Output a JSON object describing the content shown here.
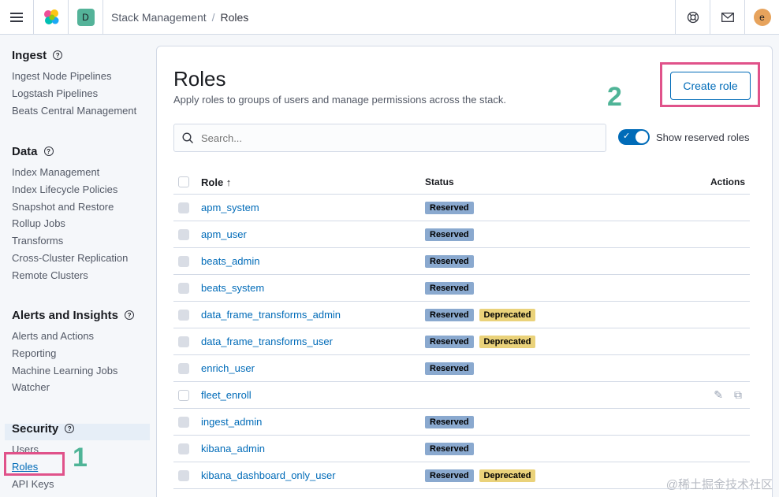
{
  "header": {
    "breadcrumbs": [
      "Stack Management",
      "Roles"
    ],
    "space_initial": "D",
    "user_initial": "e"
  },
  "sidebar": {
    "groups": [
      {
        "title": "Ingest",
        "items": [
          "Ingest Node Pipelines",
          "Logstash Pipelines",
          "Beats Central Management"
        ]
      },
      {
        "title": "Data",
        "items": [
          "Index Management",
          "Index Lifecycle Policies",
          "Snapshot and Restore",
          "Rollup Jobs",
          "Transforms",
          "Cross-Cluster Replication",
          "Remote Clusters"
        ]
      },
      {
        "title": "Alerts and Insights",
        "items": [
          "Alerts and Actions",
          "Reporting",
          "Machine Learning Jobs",
          "Watcher"
        ]
      },
      {
        "title": "Security",
        "items": [
          "Users",
          "Roles",
          "API Keys"
        ]
      }
    ],
    "active_item": "Roles"
  },
  "annotations": {
    "step1": "1",
    "step2": "2"
  },
  "main": {
    "title": "Roles",
    "description": "Apply roles to groups of users and manage permissions across the stack.",
    "create_button": "Create role",
    "search_placeholder": "Search...",
    "toggle_label": "Show reserved roles",
    "toggle_on": true,
    "columns": {
      "role": "Role",
      "status": "Status",
      "actions": "Actions"
    },
    "rows": [
      {
        "name": "apm_system",
        "badges": [
          "Reserved"
        ],
        "reserved": true
      },
      {
        "name": "apm_user",
        "badges": [
          "Reserved"
        ],
        "reserved": true
      },
      {
        "name": "beats_admin",
        "badges": [
          "Reserved"
        ],
        "reserved": true
      },
      {
        "name": "beats_system",
        "badges": [
          "Reserved"
        ],
        "reserved": true
      },
      {
        "name": "data_frame_transforms_admin",
        "badges": [
          "Reserved",
          "Deprecated"
        ],
        "reserved": true
      },
      {
        "name": "data_frame_transforms_user",
        "badges": [
          "Reserved",
          "Deprecated"
        ],
        "reserved": true
      },
      {
        "name": "enrich_user",
        "badges": [
          "Reserved"
        ],
        "reserved": true
      },
      {
        "name": "fleet_enroll",
        "badges": [],
        "reserved": false
      },
      {
        "name": "ingest_admin",
        "badges": [
          "Reserved"
        ],
        "reserved": true
      },
      {
        "name": "kibana_admin",
        "badges": [
          "Reserved"
        ],
        "reserved": true
      },
      {
        "name": "kibana_dashboard_only_user",
        "badges": [
          "Reserved",
          "Deprecated"
        ],
        "reserved": true
      }
    ]
  },
  "watermark": "@稀土掘金技术社区"
}
